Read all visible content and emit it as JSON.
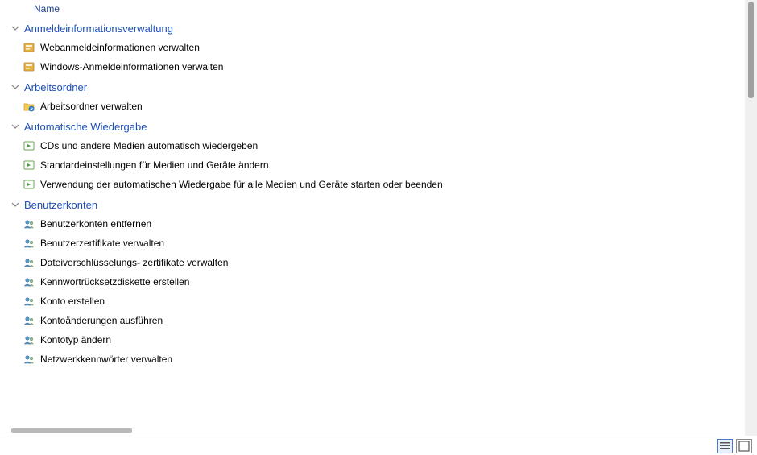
{
  "header": {
    "column_name": "Name"
  },
  "groups": [
    {
      "title": "Anmeldeinformationsverwaltung",
      "icon": "credential",
      "items": [
        {
          "label": "Webanmeldeinformationen verwalten"
        },
        {
          "label": "Windows-Anmeldeinformationen verwalten"
        }
      ]
    },
    {
      "title": "Arbeitsordner",
      "icon": "workfolder",
      "items": [
        {
          "label": "Arbeitsordner verwalten"
        }
      ]
    },
    {
      "title": "Automatische Wiedergabe",
      "icon": "autoplay",
      "items": [
        {
          "label": "CDs und andere Medien automatisch wiedergeben"
        },
        {
          "label": "Standardeinstellungen für Medien und Geräte ändern"
        },
        {
          "label": "Verwendung der automatischen Wiedergabe für alle Medien und Geräte starten oder beenden"
        }
      ]
    },
    {
      "title": "Benutzerkonten",
      "icon": "users",
      "items": [
        {
          "label": "Benutzerkonten entfernen"
        },
        {
          "label": "Benutzerzertifikate verwalten"
        },
        {
          "label": "Dateiverschlüsselungs- zertifikate verwalten"
        },
        {
          "label": "Kennwortrücksetzdiskette erstellen"
        },
        {
          "label": "Konto erstellen"
        },
        {
          "label": "Kontoänderungen ausführen"
        },
        {
          "label": "Kontotyp ändern"
        },
        {
          "label": "Netzwerkkennwörter verwalten"
        }
      ]
    }
  ]
}
